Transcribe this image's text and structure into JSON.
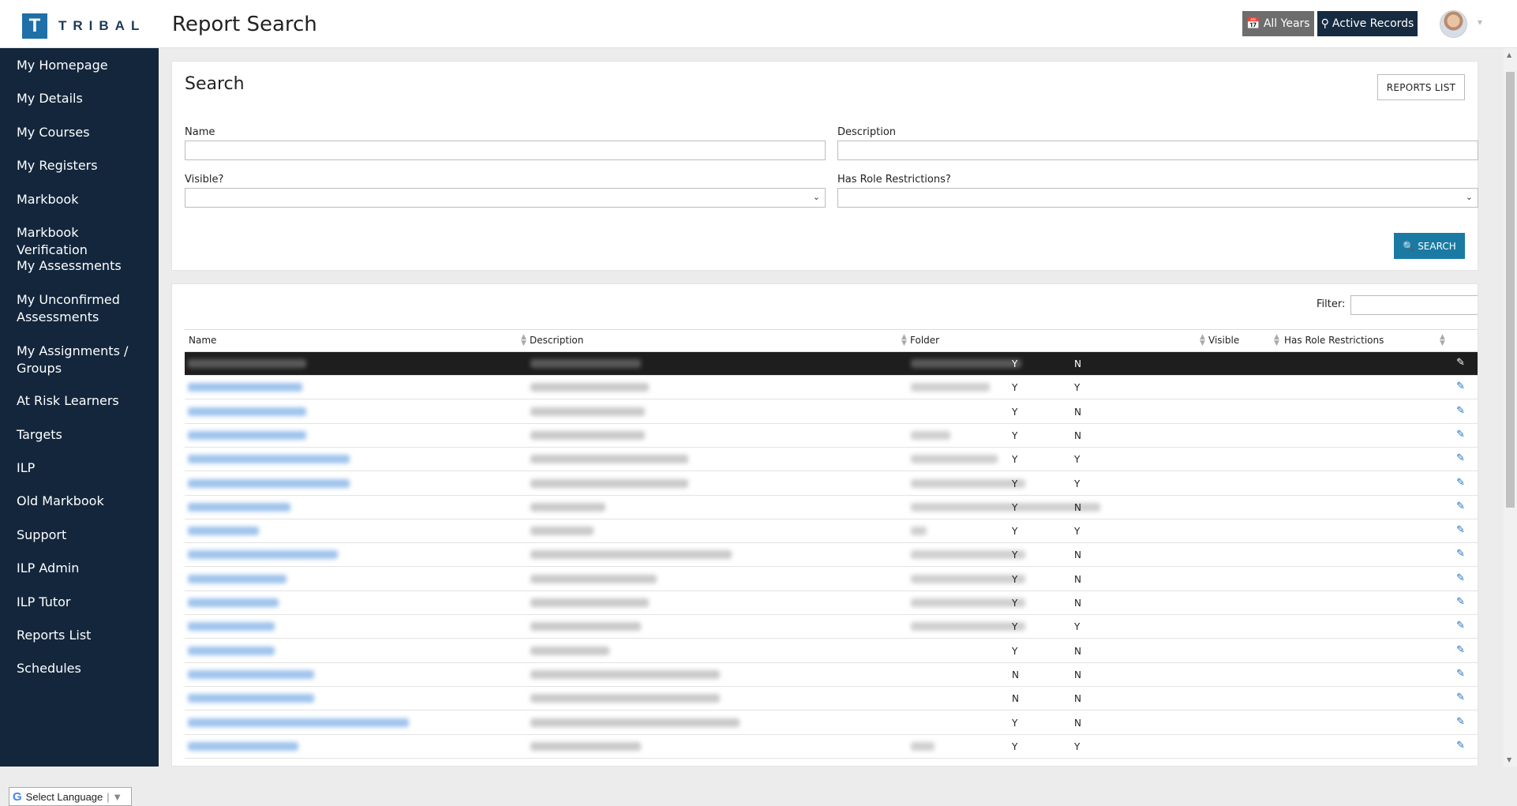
{
  "app": {
    "logo_letter": "T",
    "logo_text": "TRIBAL",
    "page_title": "Report Search",
    "years_button": "All Years",
    "active_button": "Active Records",
    "colors": {
      "sidebar": "#13263c",
      "accent": "#1a7aa3",
      "selected_row": "#1e1e1e",
      "link": "#1a6fc2"
    }
  },
  "sidebar": {
    "items": [
      "My Homepage",
      "My Details",
      "My Courses",
      "My Registers",
      "Markbook",
      "Markbook Verification",
      "My Assessments",
      "My Unconfirmed Assessments",
      "My Assignments / Groups",
      "At Risk Learners",
      "Targets",
      "ILP",
      "Old Markbook",
      "Support",
      "ILP Admin",
      "ILP Tutor",
      "Reports List",
      "Schedules"
    ],
    "language": "Select Language"
  },
  "search": {
    "title": "Search",
    "reports_list_button": "REPORTS LIST",
    "name_label": "Name",
    "description_label": "Description",
    "visible_label": "Visible?",
    "role_label": "Has Role Restrictions?",
    "search_button": "SEARCH"
  },
  "results": {
    "filter_label": "Filter:",
    "columns": [
      "Name",
      "Description",
      "Folder",
      "Visible",
      "Has Role Restrictions"
    ],
    "rows": [
      {
        "visible": "Y",
        "role": "N"
      },
      {
        "visible": "Y",
        "role": "Y"
      },
      {
        "visible": "Y",
        "role": "N"
      },
      {
        "visible": "Y",
        "role": "N"
      },
      {
        "visible": "Y",
        "role": "Y"
      },
      {
        "visible": "Y",
        "role": "Y"
      },
      {
        "visible": "Y",
        "role": "N"
      },
      {
        "visible": "Y",
        "role": "Y"
      },
      {
        "visible": "Y",
        "role": "N"
      },
      {
        "visible": "Y",
        "role": "N"
      },
      {
        "visible": "Y",
        "role": "N"
      },
      {
        "visible": "Y",
        "role": "Y"
      },
      {
        "visible": "Y",
        "role": "N"
      },
      {
        "visible": "N",
        "role": "N"
      },
      {
        "visible": "N",
        "role": "N"
      },
      {
        "visible": "Y",
        "role": "N"
      },
      {
        "visible": "Y",
        "role": "Y"
      }
    ]
  }
}
